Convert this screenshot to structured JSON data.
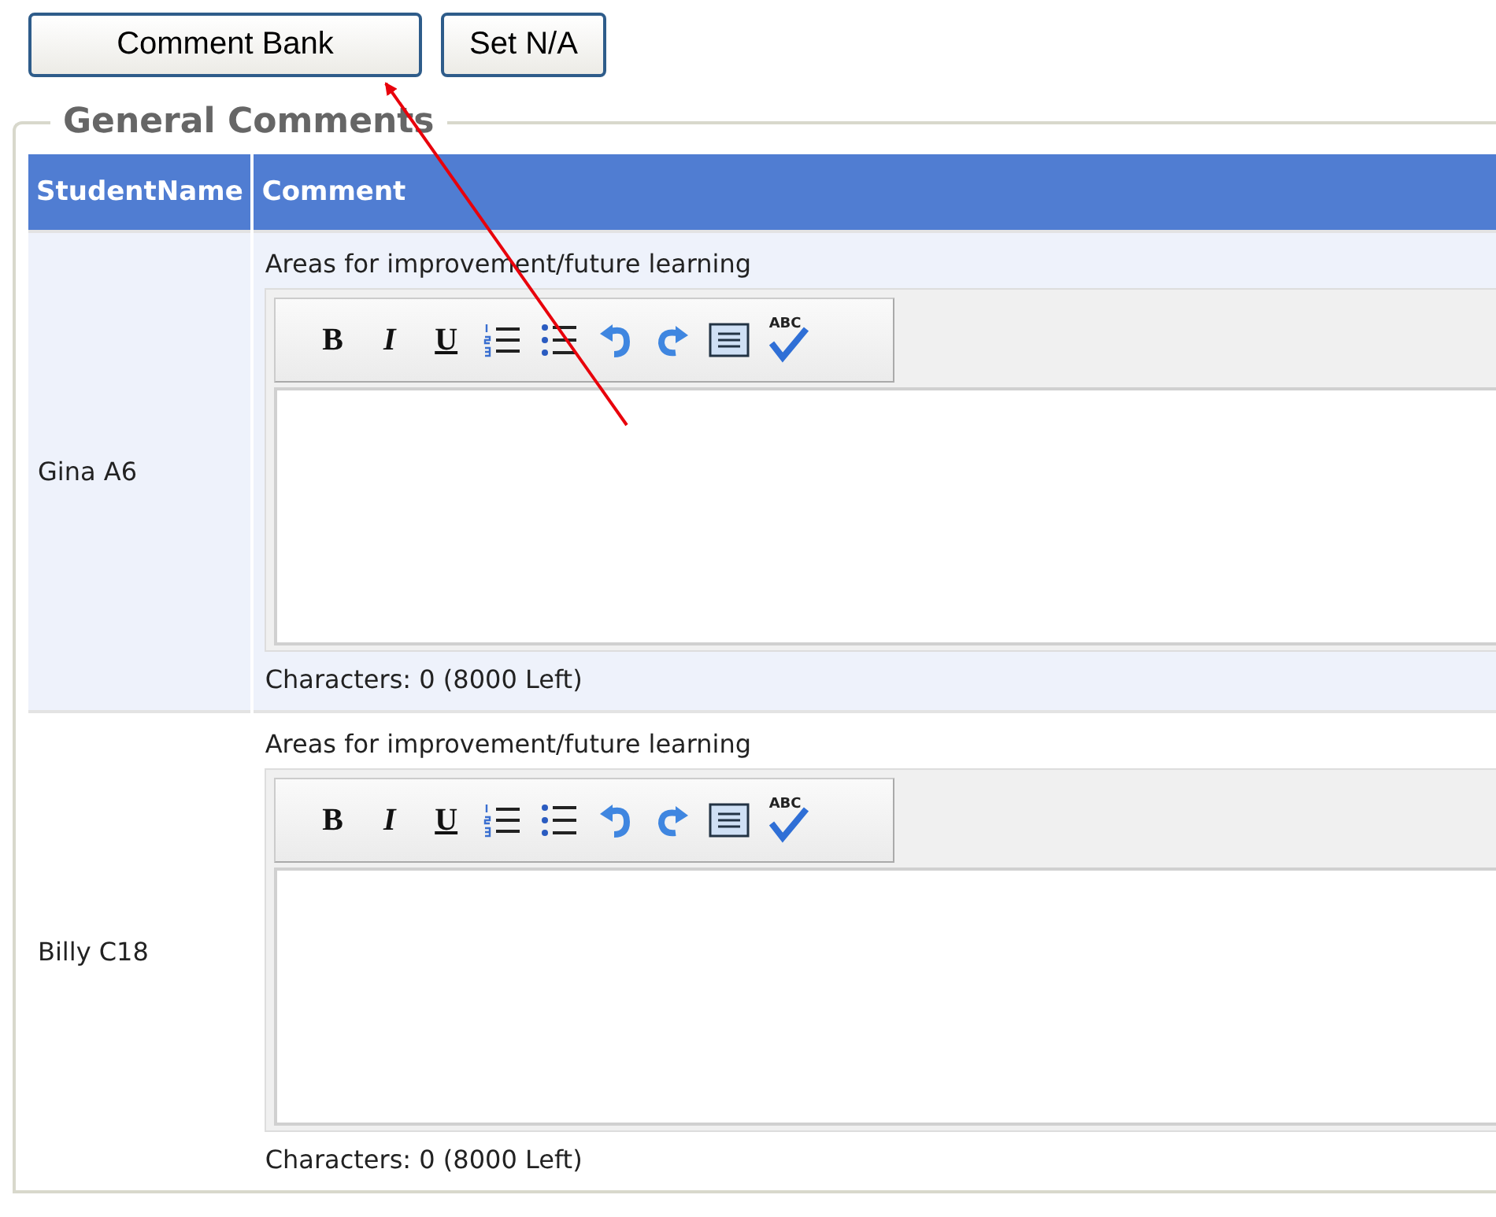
{
  "buttons": [
    {
      "label": "Comment Bank"
    },
    {
      "label": "Set N/A"
    }
  ],
  "fieldset": {
    "legend": "General Comments"
  },
  "table": {
    "columns": [
      "StudentName",
      "Comment"
    ],
    "rows": [
      {
        "student": "Gina A6",
        "field_label": "Areas for improvement/future learning",
        "value": "",
        "counter": "Characters: 0 (8000 Left)",
        "toolbar": [
          {
            "kind": "bold",
            "label": "B"
          },
          {
            "kind": "italic",
            "label": "I"
          },
          {
            "kind": "underline",
            "label": "U"
          },
          {
            "kind": "numbered-list"
          },
          {
            "kind": "bullet-list"
          },
          {
            "kind": "undo"
          },
          {
            "kind": "redo"
          },
          {
            "kind": "indent"
          },
          {
            "kind": "spellcheck",
            "label": "ABC"
          }
        ]
      },
      {
        "student": "Billy C18",
        "field_label": "Areas for improvement/future learning",
        "value": "",
        "counter": "Characters: 0 (8000 Left)",
        "toolbar": [
          {
            "kind": "bold",
            "label": "B"
          },
          {
            "kind": "italic",
            "label": "I"
          },
          {
            "kind": "underline",
            "label": "U"
          },
          {
            "kind": "numbered-list"
          },
          {
            "kind": "bullet-list"
          },
          {
            "kind": "undo"
          },
          {
            "kind": "redo"
          },
          {
            "kind": "indent"
          },
          {
            "kind": "spellcheck",
            "label": "ABC"
          }
        ]
      }
    ]
  }
}
